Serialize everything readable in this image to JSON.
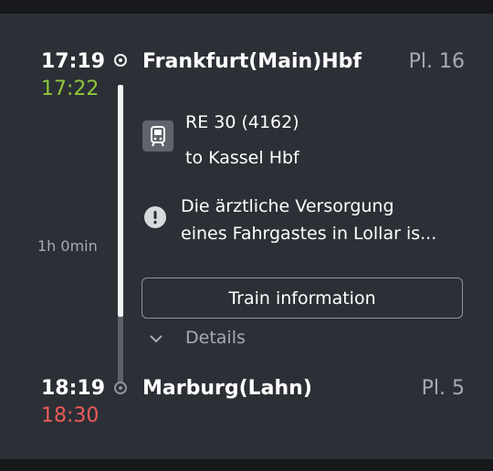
{
  "departure": {
    "planned_time": "17:19",
    "actual_time": "17:22",
    "actual_color": "#8fc73c",
    "station": "Frankfurt(Main)Hbf",
    "platform": "Pl. 16"
  },
  "arrival": {
    "planned_time": "18:19",
    "actual_time": "18:30",
    "actual_color": "#ee5a5a",
    "station": "Marburg(Lahn)",
    "platform": "Pl. 5"
  },
  "duration": "1h 0min",
  "train": {
    "icon": "train-icon",
    "name": "RE 30 (4162)",
    "direction": "to Kassel Hbf"
  },
  "notice": {
    "icon": "info-icon",
    "line1": "Die ärztliche Versorgung",
    "line2": "eines Fahrgastes in Lollar is..."
  },
  "train_info_button": "Train information",
  "details_toggle": {
    "icon": "chevron-down-icon",
    "label": "Details"
  }
}
